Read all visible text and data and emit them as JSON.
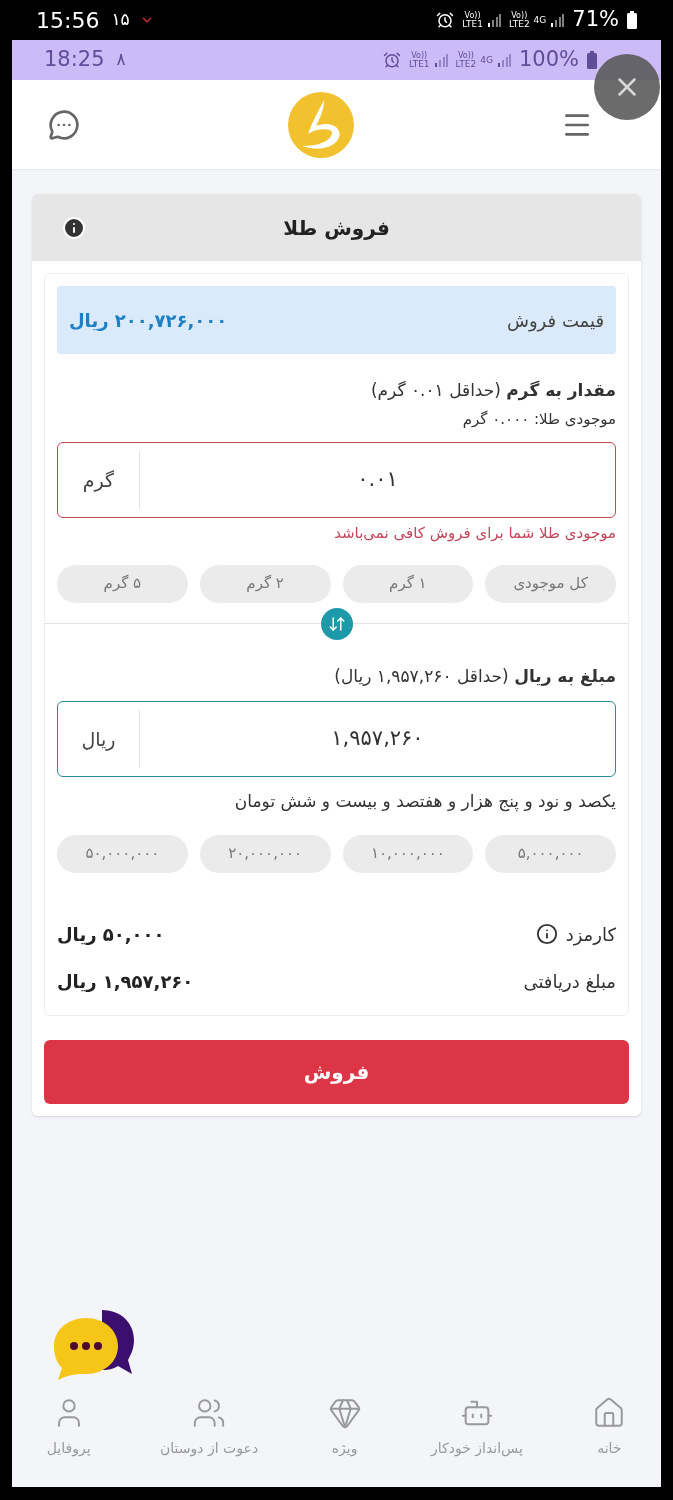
{
  "device_status_bar": {
    "time": "15:56",
    "date": "۱۵",
    "sim_1": {
      "volte": "Vo))",
      "name": "LTE1"
    },
    "sim_2": {
      "volte": "Vo))",
      "name": "LTE2",
      "network": "4G"
    },
    "battery": "71%"
  },
  "app_status_bar": {
    "time": "18:25",
    "date": "۸",
    "sim_1": {
      "volte": "Vo))",
      "name": "LTE1"
    },
    "sim_2": {
      "volte": "Vo))",
      "name": "LTE2",
      "network": "4G"
    },
    "battery": "100%"
  },
  "sell_panel": {
    "title": "فروش طلا",
    "price": {
      "label": "قیمت فروش",
      "value": "۲۰۰,۷۲۶,۰۰۰ ریال"
    },
    "fields": [
      {
        "label": "**مقدار به گرم** (حداقل ۰.۰۱ گرم)",
        "note": "موجودی طلا: ۰.۰۰۰ گرم",
        "value": "۰.۰۱",
        "unit": "گرم",
        "invalid": true,
        "focused": false,
        "message": "موجودی طلا شما برای فروش کافی نمی‌باشد",
        "quick": [
          "کل موجودی",
          "۱ گرم",
          "۲ گرم",
          "۵ گرم"
        ]
      },
      {
        "label": "**مبلغ به ریال** (حداقل ۱,۹۵۷,۲۶۰ ریال)",
        "value": "۱,۹۵۷,۲۶۰",
        "unit": "ریال",
        "invalid": false,
        "focused": true,
        "words": "یکصد و نود و پنج هزار و هفتصد و بیست و شش تومان",
        "quick": [
          "۵,۰۰۰,۰۰۰",
          "۱۰,۰۰۰,۰۰۰",
          "۲۰,۰۰۰,۰۰۰",
          "۵۰,۰۰۰,۰۰۰"
        ]
      }
    ],
    "summary": [
      {
        "label": "کارمزد",
        "value": "۵۰,۰۰۰ ریال",
        "info": true
      },
      {
        "label": "مبلغ دریافتی",
        "value": "۱,۹۵۷,۲۶۰ ریال",
        "info": false
      }
    ],
    "submit": "فروش"
  },
  "bottom_nav": [
    {
      "label": "خانه"
    },
    {
      "label": "پس‌انداز خودکار"
    },
    {
      "label": "ویژه"
    },
    {
      "label": "دعوت از دوستان"
    },
    {
      "label": "پروفایل"
    }
  ]
}
